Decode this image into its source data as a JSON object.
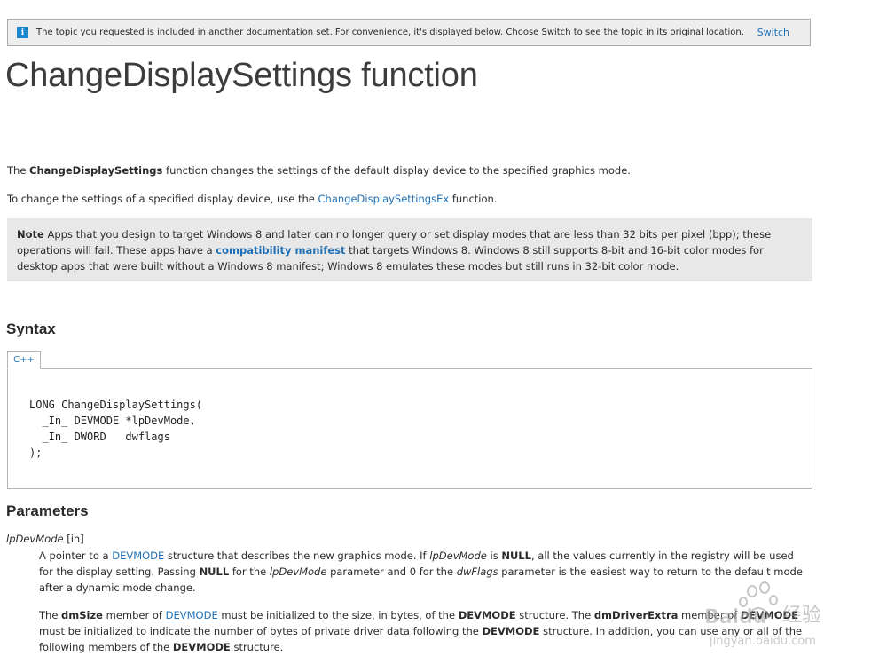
{
  "banner": {
    "icon": "i",
    "text": "The topic you requested is included in another documentation set. For convenience, it's displayed below. Choose Switch to see the topic in its original location.",
    "switch_label": "Switch"
  },
  "title": "ChangeDisplaySettings function",
  "intro": {
    "p1_before": "The ",
    "p1_bold": "ChangeDisplaySettings",
    "p1_after": " function changes the settings of the default display device to the specified graphics mode.",
    "p2_before": "To change the settings of a specified display device, use the ",
    "p2_link": "ChangeDisplaySettingsEx",
    "p2_after": " function."
  },
  "note": {
    "label": "Note",
    "text1": "  Apps that you design to target Windows 8 and later can no longer query or set display modes that are less than 32 bits per pixel (bpp); these operations will fail. These apps have a ",
    "link": "compatibility manifest",
    "text2": " that targets Windows 8. Windows 8 still supports 8-bit and 16-bit color modes for desktop apps that were built without a Windows 8 manifest; Windows 8 emulates these modes but still runs in 32-bit color mode."
  },
  "syntax": {
    "heading": "Syntax",
    "tab_label": "C++",
    "code": "LONG ChangeDisplaySettings(\n  _In_ DEVMODE *lpDevMode,\n  _In_ DWORD   dwflags\n);"
  },
  "parameters": {
    "heading": "Parameters",
    "name": "lpDevMode",
    "direction": " [in]",
    "d1": {
      "a": "A pointer to a ",
      "link": "DEVMODE",
      "b": " structure that describes the new graphics mode. If ",
      "i1": "lpDevMode",
      "c": " is ",
      "b1": "NULL",
      "d": ", all the values currently in the registry will be used for the display setting. Passing ",
      "b2": "NULL",
      "e": " for the ",
      "i2": "lpDevMode",
      "f": " parameter and 0 for the ",
      "i3": "dwFlags",
      "g": " parameter is the easiest way to return to the default mode after a dynamic mode change."
    },
    "d2": {
      "a": "The ",
      "b1": "dmSize",
      "b": " member of ",
      "link": "DEVMODE",
      "c": " must be initialized to the size, in bytes, of the ",
      "b2": "DEVMODE",
      "d": " structure. The ",
      "b3": "dmDriverExtra",
      "e": " member of ",
      "b4": "DEVMODE",
      "f": " must be initialized to indicate the number of bytes of private driver data following the ",
      "b5": "DEVMODE",
      "g": " structure. In addition, you can use any or all of the following members of the ",
      "b6": "DEVMODE",
      "h": " structure."
    }
  },
  "watermark": {
    "brand": "Baidu",
    "cn": "经验",
    "url": "jingyan.baidu.com"
  },
  "colors": {
    "link": "#1f6fb5",
    "note_bg": "#e8e8e8",
    "banner_bg": "#ededed",
    "info_icon": "#1a86d0"
  }
}
